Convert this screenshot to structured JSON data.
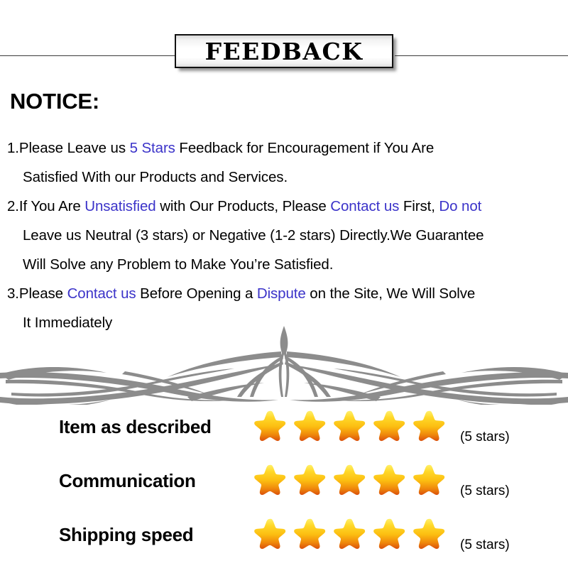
{
  "header": {
    "title": "FEEDBACK"
  },
  "notice": {
    "heading": "NOTICE:",
    "items": [
      {
        "lines": [
          [
            {
              "t": "1.Please Leave us  ",
              "hl": false
            },
            {
              "t": "5 Stars",
              "hl": true
            },
            {
              "t": "  Feedback for  Encouragement  if You Are",
              "hl": false
            }
          ],
          [
            {
              "t": "Satisfied With our Products and Services.",
              "hl": false
            }
          ]
        ]
      },
      {
        "lines": [
          [
            {
              "t": "2.If You Are ",
              "hl": false
            },
            {
              "t": "Unsatisfied",
              "hl": true
            },
            {
              "t": " with Our Products, Please ",
              "hl": false
            },
            {
              "t": "Contact us",
              "hl": true
            },
            {
              "t": " First, ",
              "hl": false
            },
            {
              "t": "Do not",
              "hl": true
            }
          ],
          [
            {
              "t": "Leave us Neutral (3 stars) or Negative (1-2 stars) Directly.We Guarantee",
              "hl": false
            }
          ],
          [
            {
              "t": "Will Solve any Problem to Make You’re  Satisfied.",
              "hl": false
            }
          ]
        ]
      },
      {
        "lines": [
          [
            {
              "t": "3.Please ",
              "hl": false
            },
            {
              "t": "Contact us",
              "hl": true
            },
            {
              "t": " Before Opening a ",
              "hl": false
            },
            {
              "t": "Dispute",
              "hl": true
            },
            {
              "t": " on the Site, We Will Solve",
              "hl": false
            }
          ],
          [
            {
              "t": "It Immediately",
              "hl": false
            }
          ]
        ]
      }
    ]
  },
  "ratings": {
    "rows": [
      {
        "label": "Item as described",
        "stars": 5,
        "count_text": "(5 stars)"
      },
      {
        "label": "Communication",
        "stars": 5,
        "count_text": "(5 stars)"
      },
      {
        "label": "Shipping speed",
        "stars": 5,
        "count_text": "(5 stars)"
      }
    ]
  },
  "colors": {
    "highlight": "#3b33c9",
    "text": "#000000",
    "ornament": "#8c8c8c",
    "star_top": "#ffe24a",
    "star_mid": "#f7b породы00",
    "star_bottom": "#e05a10"
  }
}
